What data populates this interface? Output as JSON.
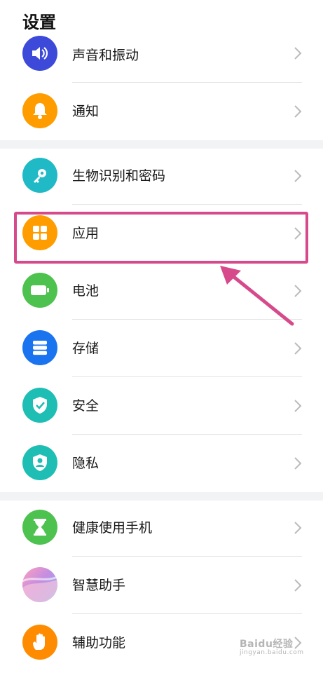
{
  "header": {
    "title": "设置"
  },
  "items": [
    {
      "label": "声音和振动",
      "icon": "volume-icon",
      "color": "#3d49d9"
    },
    {
      "label": "通知",
      "icon": "bell-icon",
      "color": "#ff9c00"
    },
    {
      "label": "生物识别和密码",
      "icon": "key-icon",
      "color": "#20b9c6"
    },
    {
      "label": "应用",
      "icon": "apps-grid-icon",
      "color": "#ff9c00"
    },
    {
      "label": "电池",
      "icon": "battery-icon",
      "color": "#4dc24f"
    },
    {
      "label": "存储",
      "icon": "storage-icon",
      "color": "#1a74f0"
    },
    {
      "label": "安全",
      "icon": "shield-check-icon",
      "color": "#1ebeb4"
    },
    {
      "label": "隐私",
      "icon": "privacy-shield-icon",
      "color": "#1ebeb4"
    },
    {
      "label": "健康使用手机",
      "icon": "hourglass-icon",
      "color": "#4dc24f"
    },
    {
      "label": "智慧助手",
      "icon": "assistant-icon",
      "color": "#c58ee0"
    },
    {
      "label": "辅助功能",
      "icon": "hand-icon",
      "color": "#ff8c00"
    }
  ],
  "annotation": {
    "highlight_color": "#d64a8c"
  },
  "watermark": {
    "text": "Baidu经验",
    "sub": "jingyan.baidu.com"
  }
}
